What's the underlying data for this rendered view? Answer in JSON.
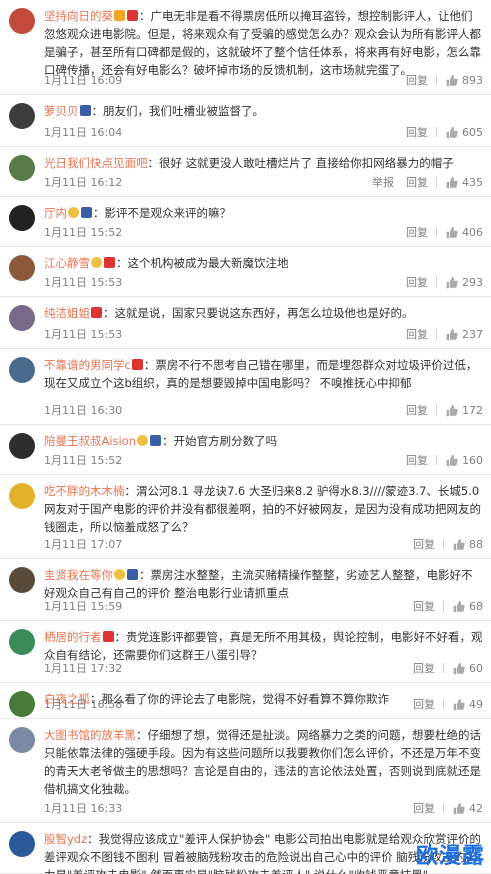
{
  "actions": {
    "reply": "回复",
    "report": "举报"
  },
  "comments": [
    {
      "user": "坚持向日的葵",
      "badges": [
        "v",
        "lv"
      ],
      "text": "：广电无非是看不得票房低所以掩耳盗铃，想控制影评人，让他们忽悠观众进电影院。但是，将来观众有了受骗的感觉怎么办？观众会认为所有影评人都是骗子，甚至所有口碑都是假的，这就破坏了整个信任体系，将来再有好电影，怎么靠口碑传播，还会有好电影么？破坏掉市场的反馈机制，这市场就完蛋了。",
      "time": "1月11日 16:09",
      "likes": "893",
      "avatar": "#c14a3a",
      "report": false
    },
    {
      "user": "萝贝贝",
      "badges": [
        "vip"
      ],
      "text": "：朋友们，我们吐槽业被监督了。",
      "time": "1月11日 16:04",
      "likes": "605",
      "avatar": "#3d3d3d",
      "report": false
    },
    {
      "user": "光日我们快点见面吧",
      "badges": [],
      "text": "：很好 这就更没人敢吐槽烂片了 直接给你扣网络暴力的帽子",
      "time": "1月11日 16:12",
      "likes": "435",
      "avatar": "#5b7a4a",
      "report": true
    },
    {
      "user": "厅内",
      "badges": [
        "crown",
        "vip"
      ],
      "text": "：影评不是观众来评的嘛？",
      "time": "1月11日 15:52",
      "likes": "406",
      "avatar": "#222222",
      "report": false
    },
    {
      "user": "江心静雪",
      "badges": [
        "crown",
        "lv"
      ],
      "text": "：这个机构被成为最大新魔饮注地",
      "time": "1月11日 15:53",
      "likes": "293",
      "avatar": "#8b5a3c",
      "report": false
    },
    {
      "user": "纯洁姐姐",
      "badges": [
        "lv"
      ],
      "text": "：这就是说，国家只要说这东西好，再怎么垃圾他也是好的。",
      "time": "1月11日 15:53",
      "likes": "237",
      "avatar": "#7a6a8a",
      "report": false
    },
    {
      "user": "不靠谱的男同学c",
      "badges": [
        "lv"
      ],
      "text": "：票房不行不思考自己错在哪里，而是埋怨群众对垃圾评价过低，现在又成立个这b组织，真的是想要毁掉中国电影吗？ 不嗅推抚心中抑郁",
      "time": "1月11日 16:30",
      "likes": "172",
      "avatar": "#4a6a8c",
      "report": false
    },
    {
      "user": "陪曼王叔叔Aision",
      "badges": [
        "crown",
        "vip"
      ],
      "text": "：开始官方刷分数了吗",
      "time": "1月11日 15:52",
      "likes": "160",
      "avatar": "#2e2e2e",
      "report": false
    },
    {
      "user": "吃不胖的木木楠",
      "badges": [],
      "text": "：渭公河8.1 寻龙诀7.6 大圣归来8.2 驴得水8.3////蒙迹3.7、长城5.0 网友对于国产电影的评价并没有都很差啊，拍的不好被网友，是因为没有成功把网友的钱圈走，所以恼羞成怒了么？",
      "time": "1月11日 17:07",
      "likes": "88",
      "avatar": "#e2b32a",
      "report": false
    },
    {
      "user": "圭贤我在等你",
      "badges": [
        "crown",
        "vip"
      ],
      "text": "：票房注水整整，主流买赌精操作整整，劣迹艺人整整，电影好不好观众自己有自己的评价 整治电影行业请抓重点",
      "time": "1月11日 15:59",
      "likes": "68",
      "avatar": "#5a4a3a",
      "report": false
    },
    {
      "user": "栖居的行者",
      "badges": [
        "lv"
      ],
      "text": "：贵党连影评都要管，真是无所不用其极，舆论控制，电影好不好看，观众自有结论，还需要你们这群王八蛋引导？",
      "time": "1月11日 17:32",
      "likes": "60",
      "avatar": "#3a8a5a",
      "report": false
    },
    {
      "user": "白夜之狐",
      "badges": [],
      "text": "：那么看了你的评论去了电影院，觉得不好看算不算你欺诈",
      "time": "1月11日 16:58",
      "likes": "49",
      "avatar": "#4a7a3a",
      "report": false
    },
    {
      "user": "大图书馆的放羊黑",
      "badges": [],
      "text": "：仔细想了想，觉得还是扯淡。网络暴力之类的问题，想要杜绝的话只能依靠法律的强硬手段。因为有这些问题所以我要教你们怎么评价，不还是万年不变的青天大老爷做主的思想吗？言论是自由的，违法的言论依法处置，否则说到底就还是借机搞文化独裁。",
      "time": "1月11日 16:33",
      "likes": "42",
      "avatar": "#7a8aa5",
      "report": false
    },
    {
      "user": "股智ydz",
      "badges": [],
      "text": "：我觉得应该成立\"差评人保护协会\" 电影公司拍出电影就是给观众欣赏评价的 差评观众不图钱不图利 冒着被脑残粉攻击的危险说出自己心中的评价 脑残粉攻击的实力是\"差评攻击电影\" 然而事实是\"脑残粉攻击差评人\" 说什么\"收钱恶意抹黑\"",
      "time": "",
      "likes": "",
      "avatar": "#2a5a9a",
      "report": false
    }
  ],
  "watermark": "欧漫露"
}
